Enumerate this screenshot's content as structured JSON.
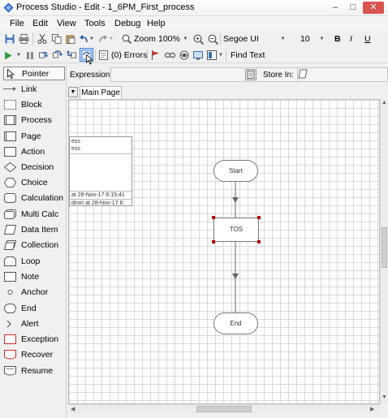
{
  "window": {
    "title": "Process Studio - Edit - 1_6PM_First_process",
    "min_glyph": "–",
    "max_glyph": "□",
    "close_glyph": "✕"
  },
  "menu": [
    "File",
    "Edit",
    "View",
    "Tools",
    "Debug",
    "Help"
  ],
  "toolbar1": {
    "zoom_label": "Zoom",
    "zoom_value": "100%",
    "font_name": "Segoe UI",
    "font_size": "10",
    "bold": "B",
    "italic": "I",
    "underline": "U"
  },
  "toolbar2": {
    "errors_label": "(0) Errors",
    "find_text_label": "Find Text"
  },
  "toolbox": [
    {
      "label": "Pointer",
      "icon": "pointer-icon"
    },
    {
      "label": "Link",
      "icon": "link-icon"
    },
    {
      "label": "Block",
      "icon": "block-icon"
    },
    {
      "label": "Process",
      "icon": "process-icon"
    },
    {
      "label": "Page",
      "icon": "page-icon"
    },
    {
      "label": "Action",
      "icon": "action-icon"
    },
    {
      "label": "Decision",
      "icon": "decision-icon"
    },
    {
      "label": "Choice",
      "icon": "choice-icon"
    },
    {
      "label": "Calculation",
      "icon": "calculation-icon"
    },
    {
      "label": "Multi Calc",
      "icon": "multi-calc-icon"
    },
    {
      "label": "Data Item",
      "icon": "data-item-icon"
    },
    {
      "label": "Collection",
      "icon": "collection-icon"
    },
    {
      "label": "Loop",
      "icon": "loop-icon"
    },
    {
      "label": "Note",
      "icon": "note-icon"
    },
    {
      "label": "Anchor",
      "icon": "anchor-icon"
    },
    {
      "label": "End",
      "icon": "end-icon"
    },
    {
      "label": "Alert",
      "icon": "alert-icon"
    },
    {
      "label": "Exception",
      "icon": "exception-icon"
    },
    {
      "label": "Recover",
      "icon": "recover-icon"
    },
    {
      "label": "Resume",
      "icon": "resume-icon"
    }
  ],
  "expression": {
    "label": "Expression:",
    "value": "",
    "store_in_label": "Store In:",
    "store_in_value": ""
  },
  "tabs": {
    "active": "Main Page"
  },
  "info_panel": {
    "line1": "ess",
    "line2": "ess",
    "line3": "at 28-Nov-17 6:15:41",
    "line4": "dmin at 28-Nov-17 6:"
  },
  "diagram": {
    "start_label": "Start",
    "action_label": "TOS",
    "end_label": "End"
  },
  "colors": {
    "selection_handle": "#b00000",
    "close_button": "#d9534f",
    "sync_highlight": "#cde0f7"
  }
}
